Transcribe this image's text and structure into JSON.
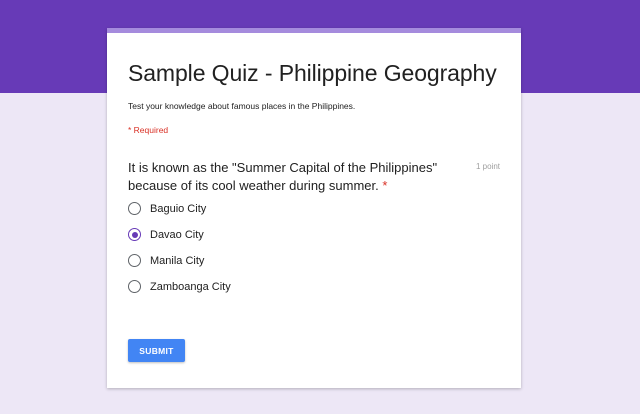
{
  "colors": {
    "banner": "#673ab7",
    "background": "#ede7f6",
    "card_accent": "#a58bdd",
    "selected_radio": "#673ab7",
    "required": "#d93025",
    "submit_button": "#4285f4"
  },
  "form": {
    "title": "Sample Quiz - Philippine Geography",
    "description": "Test your knowledge about famous places in the Philippines.",
    "required_notice": "* Required"
  },
  "question": {
    "text": "It is known as the \"Summer Capital of the Philippines\" because of its cool weather during summer.",
    "required_marker": "*",
    "points": "1 point",
    "selected_index": 1,
    "options": [
      {
        "label": "Baguio City",
        "selected": false
      },
      {
        "label": "Davao City",
        "selected": true
      },
      {
        "label": "Manila City",
        "selected": false
      },
      {
        "label": "Zamboanga City",
        "selected": false
      }
    ]
  },
  "submit_label": "SUBMIT"
}
